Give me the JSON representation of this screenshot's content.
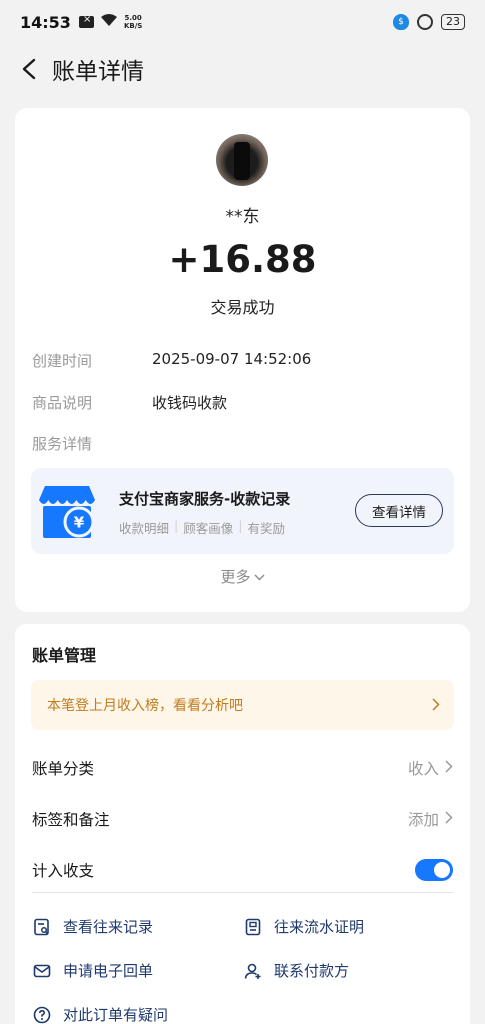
{
  "status_bar": {
    "time": "14:53",
    "speed": "5.00",
    "speed_unit": "KB/S",
    "battery": "23"
  },
  "header": {
    "title": "账单详情"
  },
  "transaction": {
    "payer": "**东",
    "amount": "+16.88",
    "status": "交易成功",
    "details": [
      {
        "label": "创建时间",
        "value": "2025-09-07 14:52:06"
      },
      {
        "label": "商品说明",
        "value": "收钱码收款"
      },
      {
        "label": "服务详情",
        "value": ""
      }
    ]
  },
  "service": {
    "title": "支付宝商家服务-收款记录",
    "tags": [
      "收款明细",
      "顾客画像",
      "有奖励"
    ],
    "button_label": "查看详情",
    "accent_color": "#1677ff"
  },
  "more_label": "更多",
  "manage": {
    "title": "账单管理",
    "promo": "本笔登上月收入榜，看看分析吧",
    "settings": [
      {
        "label": "账单分类",
        "value": "收入"
      },
      {
        "label": "标签和备注",
        "value": "添加"
      },
      {
        "label": "计入收支",
        "toggle": true
      }
    ],
    "actions": [
      {
        "label": "查看往来记录",
        "icon": "search-record-icon"
      },
      {
        "label": "往来流水证明",
        "icon": "document-icon"
      },
      {
        "label": "申请电子回单",
        "icon": "mail-icon"
      },
      {
        "label": "联系付款方",
        "icon": "contact-user-icon"
      },
      {
        "label": "对此订单有疑问",
        "icon": "question-icon"
      }
    ]
  }
}
